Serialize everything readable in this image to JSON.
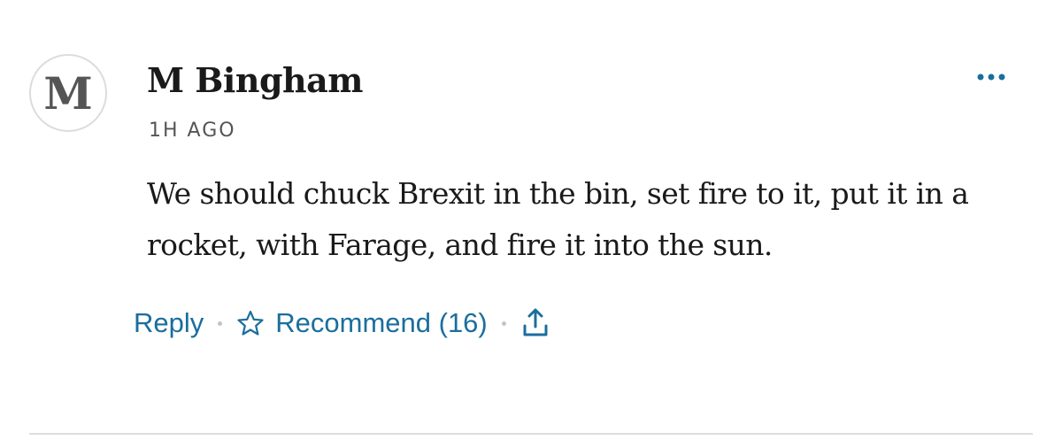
{
  "comment": {
    "avatar_letter": "M",
    "author": "M Bingham",
    "time": "1H AGO",
    "body": "We should chuck Brexit in the bin, set fire to it, put it in a rocket, with Farage, and fire it into the sun."
  },
  "actions": {
    "reply_label": "Reply",
    "recommend_label": "Recommend (16)",
    "star_icon": "star-outline-icon",
    "share_icon": "share-upload-icon",
    "more_icon": "more-horizontal-icon"
  },
  "colors": {
    "accent": "#1b6e9c",
    "text": "#1a1a1a",
    "muted": "#555555",
    "separator": "#c4c4c4",
    "divider": "#dddddd"
  }
}
